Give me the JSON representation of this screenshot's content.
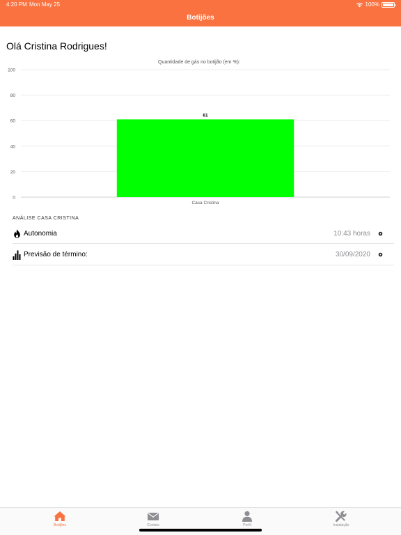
{
  "status_bar": {
    "time": "4:20 PM",
    "date": "Mon May 25",
    "battery": "100%"
  },
  "nav": {
    "title": "Botijões"
  },
  "greeting": "Olá Cristina Rodrigues!",
  "chart_data": {
    "type": "bar",
    "title": "Quantidade de gás no botijão (em %):",
    "categories": [
      "Casa Cristina"
    ],
    "values": [
      61
    ],
    "ylim": [
      0,
      100
    ],
    "yticks": [
      0,
      20,
      40,
      60,
      80,
      100
    ],
    "grid": true,
    "bar_color": "#00ff00"
  },
  "analysis": {
    "section_label": "ANÁLISE CASA CRISTINA",
    "rows": [
      {
        "label": "Autonomia",
        "value": "10:43 horas",
        "icon": "flame-icon"
      },
      {
        "label": "Previsão de término:",
        "value": "30/09/2020",
        "icon": "bar-chart-icon"
      }
    ]
  },
  "tabs": [
    {
      "label": "Botijões",
      "icon": "home-icon",
      "active": true
    },
    {
      "label": "Contato",
      "icon": "mail-icon",
      "active": false
    },
    {
      "label": "Perfil",
      "icon": "person-icon",
      "active": false
    },
    {
      "label": "Instalação",
      "icon": "tools-icon",
      "active": false
    }
  ],
  "colors": {
    "accent": "#f97240",
    "bar": "#00ff00"
  }
}
